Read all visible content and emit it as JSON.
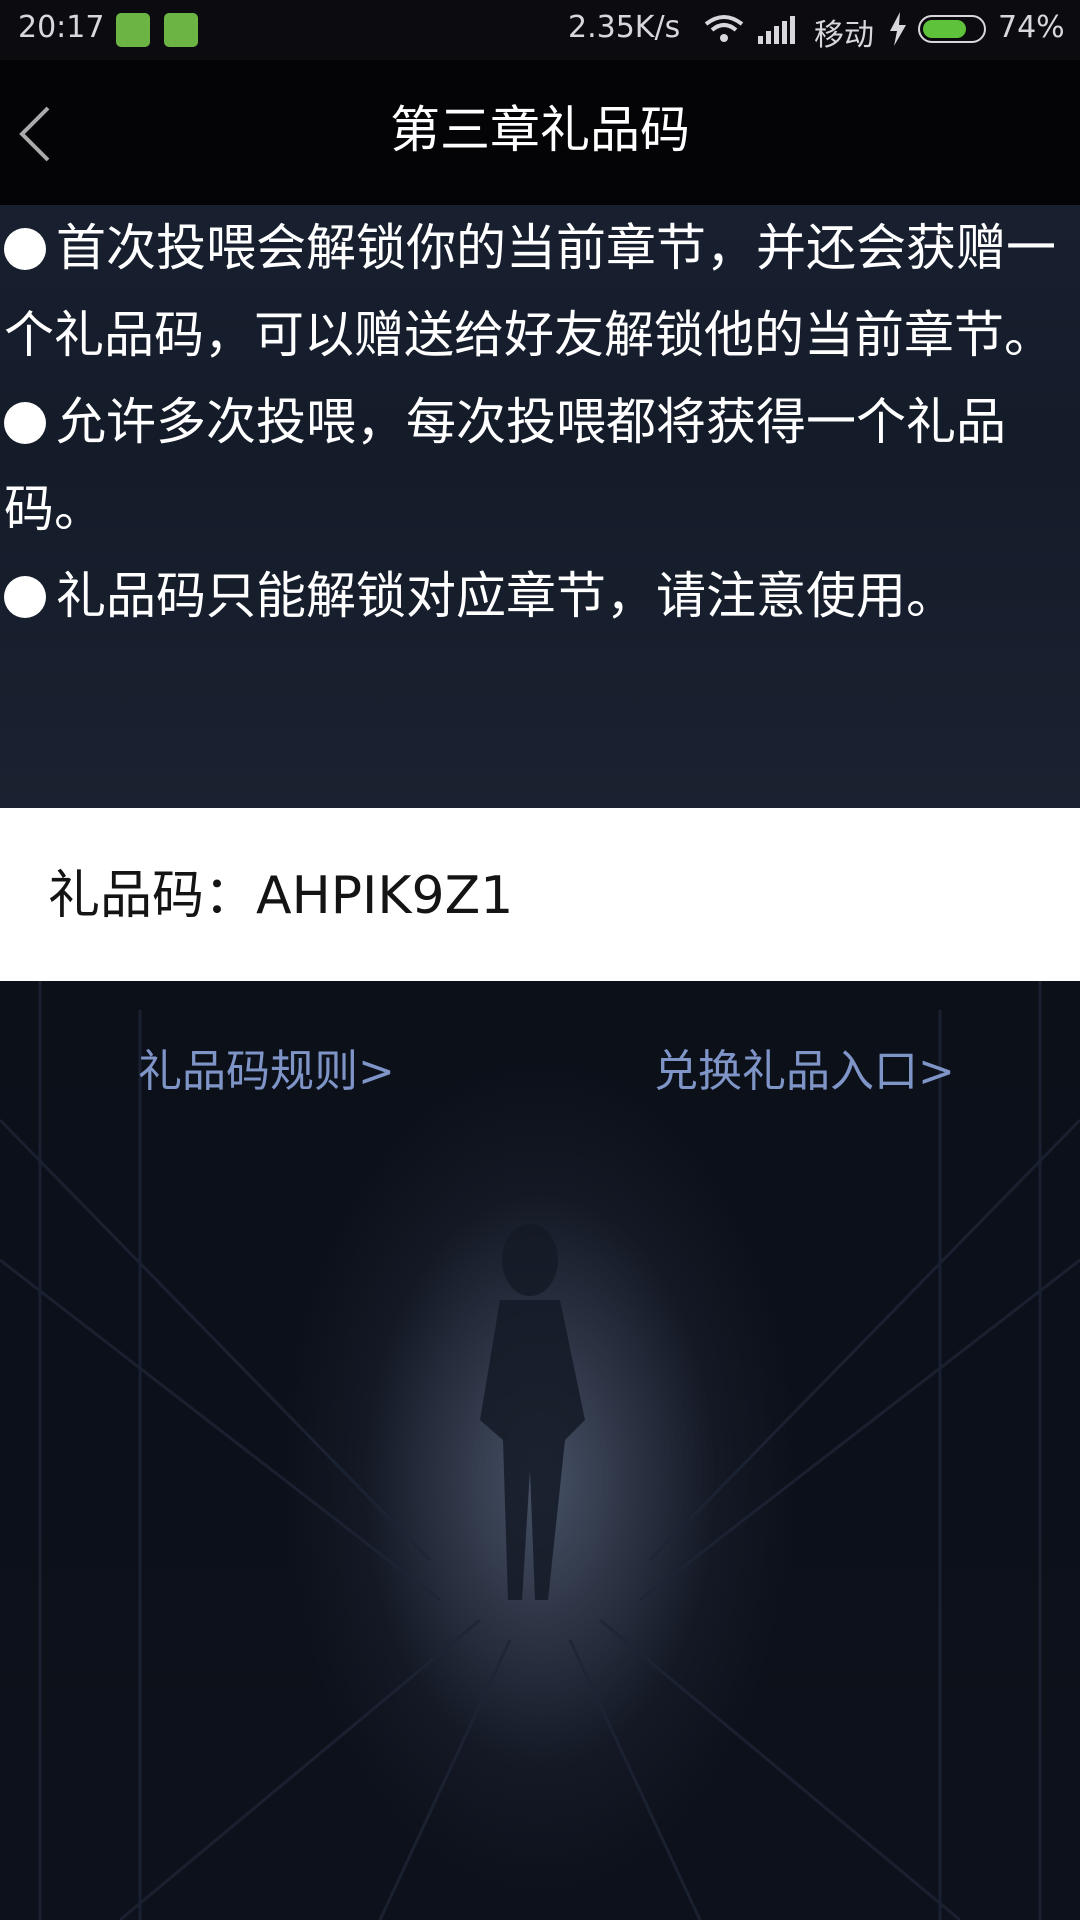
{
  "status_bar": {
    "time": "20:17",
    "net_speed": "2.35K/s",
    "carrier": "移动",
    "battery_percent": "74%",
    "battery_level": 0.74
  },
  "header": {
    "title": "第三章礼品码",
    "back_icon": "chevron-left-icon"
  },
  "rules": [
    {
      "text": "首次投喂会解锁你的当前章节，并还会获赠一个礼品码，可以赠送给好友解锁他的当前章节。"
    },
    {
      "text": "允许多次投喂，每次投喂都将获得一个礼品码。"
    },
    {
      "text": "礼品码只能解锁对应章节，请注意使用。"
    }
  ],
  "gift_code": {
    "label": "礼品码：",
    "value": "AHPIK9Z1"
  },
  "links": {
    "rules_label": "礼品码规则>",
    "redeem_label": "兑换礼品入口>"
  },
  "colors": {
    "link": "#7f95c8",
    "battery_fill": "#5ec33a",
    "badge_green": "#6cb545"
  }
}
